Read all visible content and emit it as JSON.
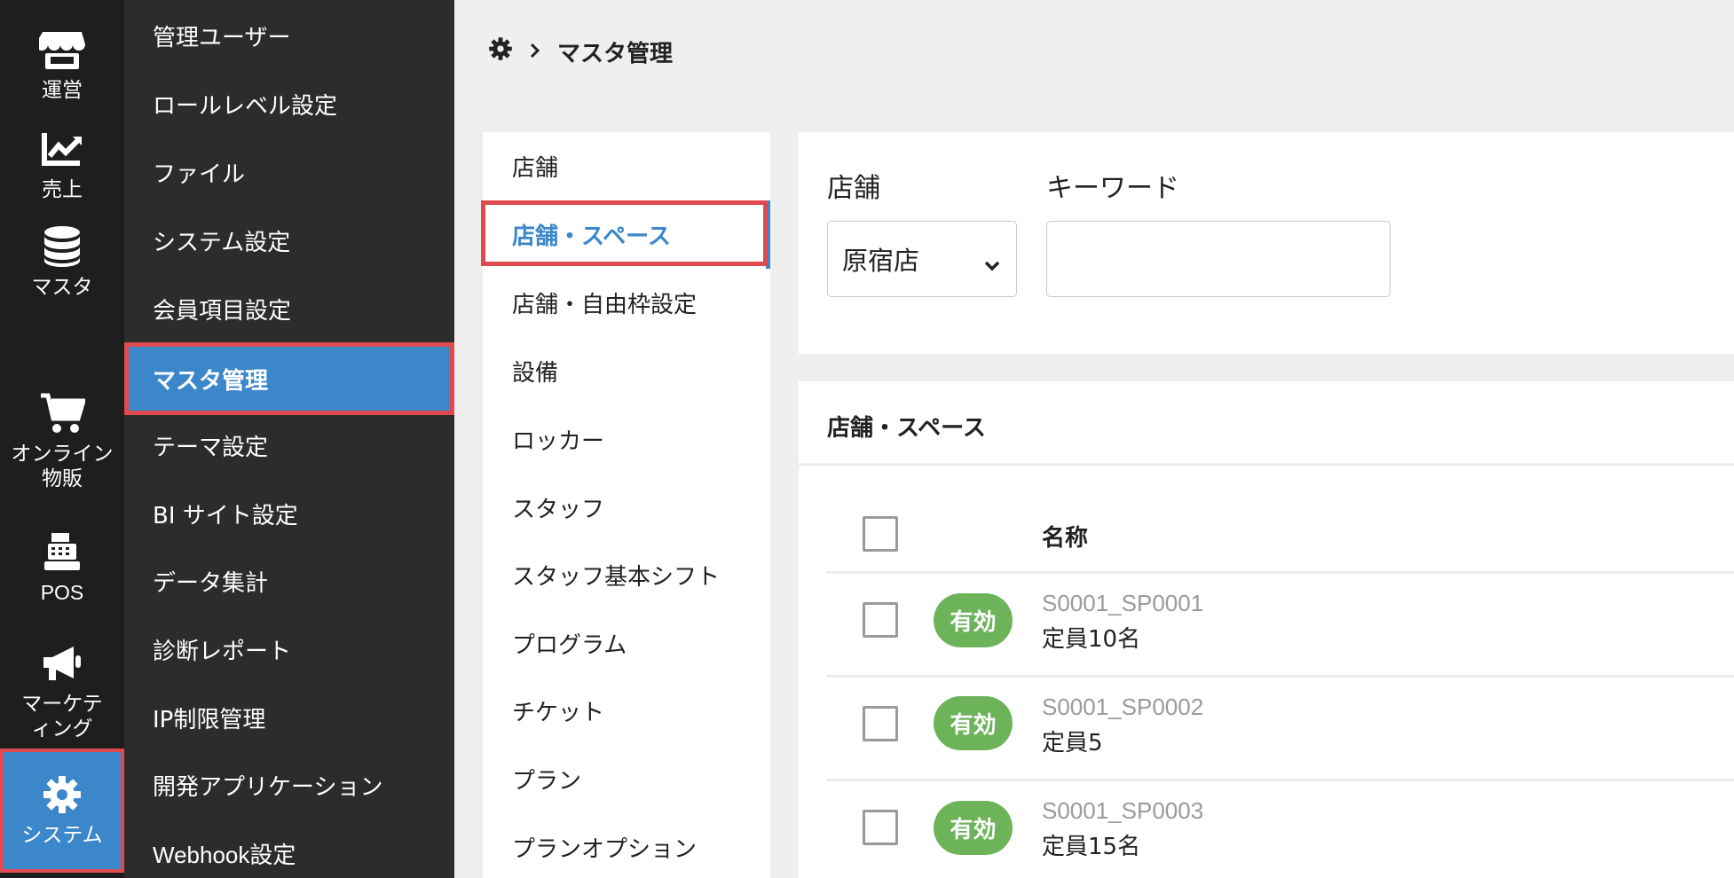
{
  "rail": [
    {
      "label": "運営",
      "icon": "store-icon"
    },
    {
      "label": "売上",
      "icon": "chart-icon"
    },
    {
      "label": "マスタ",
      "icon": "database-icon"
    },
    {
      "label": "オンライン物販",
      "icon": "cart-icon"
    },
    {
      "label": "POS",
      "icon": "cash-register-icon"
    },
    {
      "label": "マーケティング",
      "icon": "megaphone-icon"
    },
    {
      "label": "システム",
      "icon": "gear-icon",
      "active": true
    }
  ],
  "menu": [
    "管理ユーザー",
    "ロールレベル設定",
    "ファイル",
    "システム設定",
    "会員項目設定",
    "マスタ管理",
    "テーマ設定",
    "BI サイト設定",
    "データ集計",
    "診断レポート",
    "IP制限管理",
    "開発アプリケーション",
    "Webhook設定"
  ],
  "menu_active": "マスタ管理",
  "breadcrumb": {
    "current": "マスタ管理"
  },
  "subnav": [
    "店舗",
    "店舗・スペース",
    "店舗・自由枠設定",
    "設備",
    "ロッカー",
    "スタッフ",
    "スタッフ基本シフト",
    "プログラム",
    "チケット",
    "プラン",
    "プランオプション"
  ],
  "subnav_active": "店舗・スペース",
  "filter": {
    "store_label": "店舗",
    "store_value": "原宿店",
    "keyword_label": "キーワード",
    "keyword_value": ""
  },
  "list": {
    "title": "店舗・スペース",
    "column_name": "名称",
    "rows": [
      {
        "status": "有効",
        "code": "S0001_SP0001",
        "caption": "定員10名"
      },
      {
        "status": "有効",
        "code": "S0001_SP0002",
        "caption": "定員5"
      },
      {
        "status": "有効",
        "code": "S0001_SP0003",
        "caption": "定員15名"
      }
    ]
  },
  "colors": {
    "rail_bg": "#1e1e1e",
    "menu_bg": "#2c2c2c",
    "accent": "#3b87c9",
    "highlight": "#e04a4f",
    "badge_green": "#6db35a"
  }
}
